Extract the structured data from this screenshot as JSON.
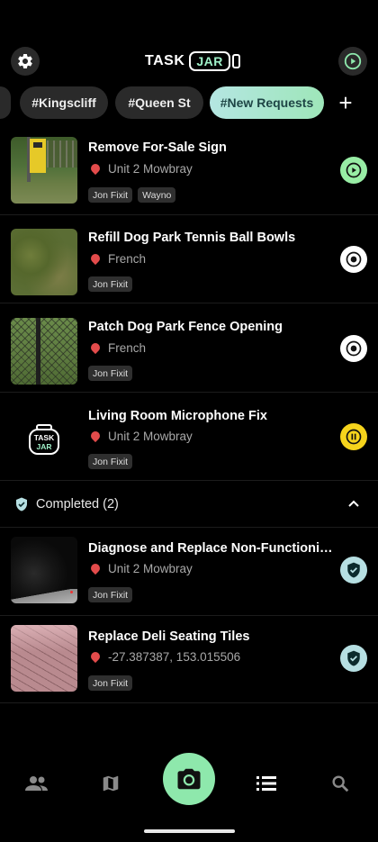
{
  "header": {
    "logo_task": "TASK",
    "logo_jar": "JAR",
    "settings_icon": "gear-icon",
    "play_icon": "play-circle-icon"
  },
  "tags": {
    "items": [
      "#Kingscliff",
      "#Queen St",
      "#New Requests"
    ],
    "active": "#New Requests",
    "add_label": "+"
  },
  "tasks": [
    {
      "title": "Remove For-Sale Sign",
      "location": "Unit 2 Mowbray",
      "assignees": [
        "Jon Fixit",
        "Wayno"
      ],
      "status": "play"
    },
    {
      "title": "Refill Dog Park Tennis Ball Bowls",
      "location": "French",
      "assignees": [
        "Jon Fixit"
      ],
      "status": "target"
    },
    {
      "title": "Patch Dog Park Fence Opening",
      "location": "French",
      "assignees": [
        "Jon Fixit"
      ],
      "status": "target"
    },
    {
      "title": "Living Room Microphone Fix",
      "location": "Unit 2 Mowbray",
      "assignees": [
        "Jon Fixit"
      ],
      "status": "pause",
      "thumb_logo_line1": "TASK",
      "thumb_logo_line2": "JAR"
    }
  ],
  "completed": {
    "label": "Completed (2)",
    "count": 2,
    "expanded": true,
    "items": [
      {
        "title": "Diagnose and Replace Non-Functionin...",
        "location": "Unit 2 Mowbray",
        "assignees": [
          "Jon Fixit"
        ],
        "status": "done"
      },
      {
        "title": "Replace Deli Seating Tiles",
        "location": "-27.387387, 153.015506",
        "assignees": [
          "Jon Fixit"
        ],
        "status": "done"
      }
    ]
  },
  "bottom_nav": {
    "items": [
      "people-icon",
      "map-icon",
      "camera-icon",
      "list-icon",
      "search-icon"
    ],
    "active": "list-icon"
  },
  "colors": {
    "background": "#000000",
    "accent_green": "#8ee8ac",
    "active_tag_gradient_start": "#b4e6e2",
    "pause_yellow": "#f6d41c",
    "done_blue": "#b6dfe2"
  }
}
